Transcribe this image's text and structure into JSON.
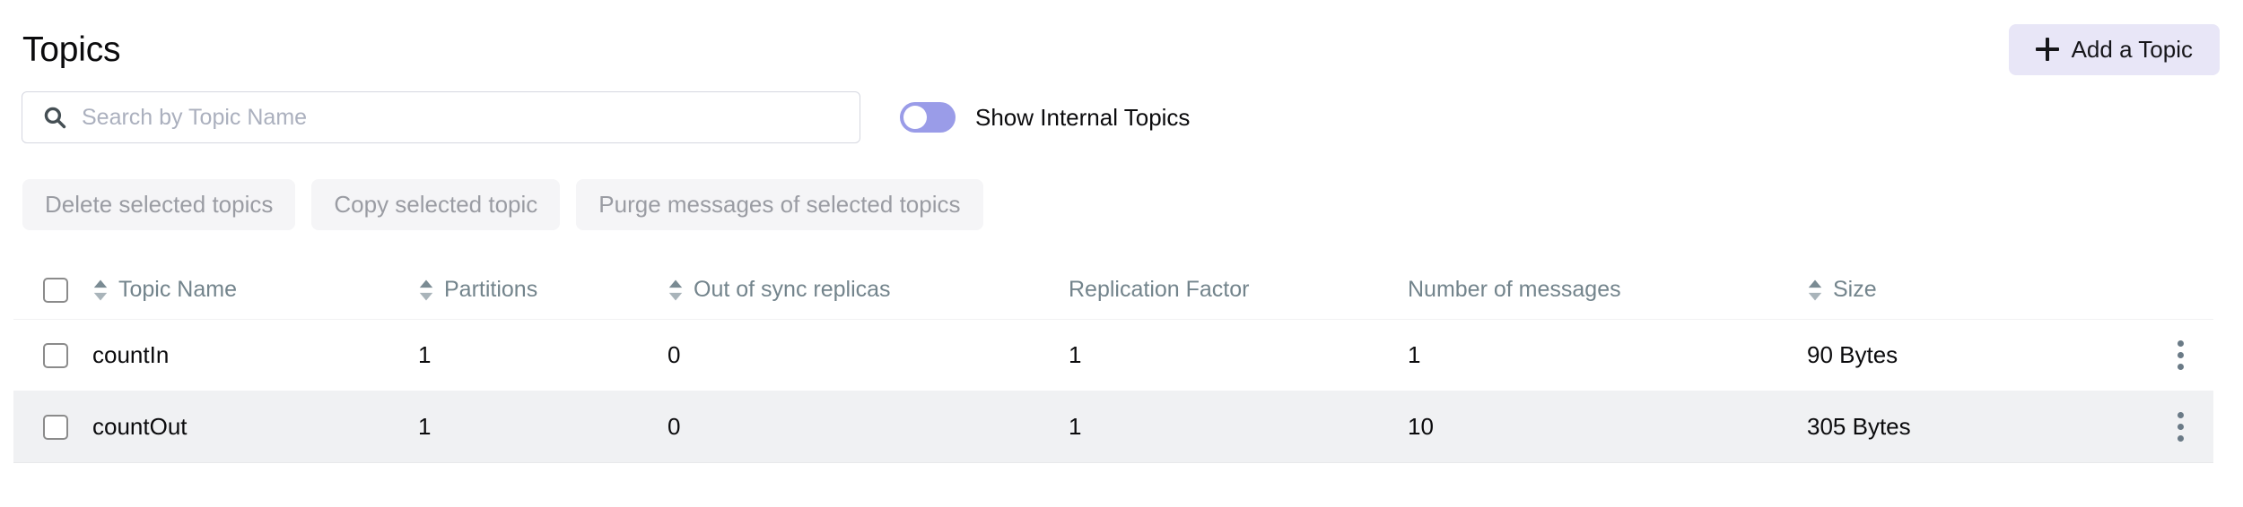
{
  "header": {
    "title": "Topics",
    "add_topic_label": "Add a Topic",
    "add_topic_icon": "plus-icon",
    "accent_color": "#E8E6F7"
  },
  "search": {
    "placeholder": "Search by Topic Name",
    "value": "",
    "icon": "search-icon"
  },
  "internal_toggle": {
    "label": "Show Internal Topics",
    "state": "off",
    "color": "#9A9CE8"
  },
  "bulk_actions": [
    {
      "label": "Delete selected topics",
      "disabled": true
    },
    {
      "label": "Copy selected topic",
      "disabled": true
    },
    {
      "label": "Purge messages of selected topics",
      "disabled": true
    }
  ],
  "table": {
    "columns": [
      {
        "label": "Topic Name",
        "sortable": true
      },
      {
        "label": "Partitions",
        "sortable": true
      },
      {
        "label": "Out of sync replicas",
        "sortable": true
      },
      {
        "label": "Replication Factor",
        "sortable": false
      },
      {
        "label": "Number of messages",
        "sortable": false
      },
      {
        "label": "Size",
        "sortable": true
      }
    ],
    "rows": [
      {
        "name": "countIn",
        "partitions": "1",
        "out_of_sync_replicas": "0",
        "replication_factor": "1",
        "number_of_messages": "1",
        "size": "90 Bytes",
        "selected": false,
        "highlighted": false
      },
      {
        "name": "countOut",
        "partitions": "1",
        "out_of_sync_replicas": "0",
        "replication_factor": "1",
        "number_of_messages": "10",
        "size": "305 Bytes",
        "selected": false,
        "highlighted": true
      }
    ]
  }
}
